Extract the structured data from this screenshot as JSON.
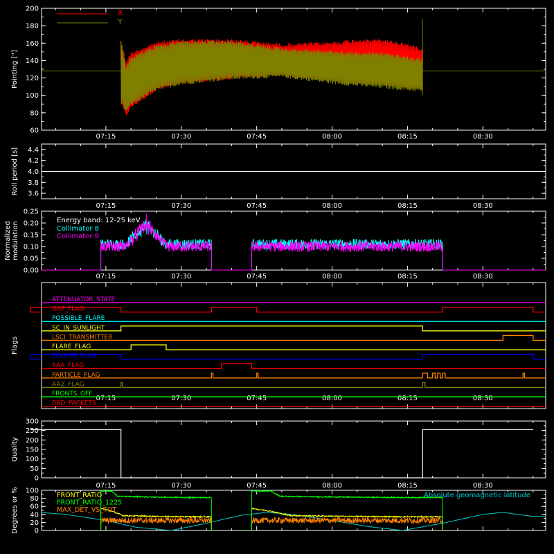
{
  "colors": {
    "background": "#000000",
    "axes": "#ffffff",
    "x_pointing": "#ff0000",
    "y_pointing": "#808000",
    "coll8": "#00ffff",
    "coll9": "#ff00ff",
    "front_ratio": "#ffff00",
    "front_ratio_1225": "#00ff00",
    "max_det_vs_tot": "#ff8000",
    "geomag": "#00cccc"
  },
  "chart_data": [
    {
      "type": "line",
      "ylabel": "Pointing [\"]",
      "ylim": [
        60,
        200
      ],
      "yticks": [
        60,
        80,
        100,
        120,
        140,
        160,
        180,
        200
      ],
      "xticks": [
        "07:15",
        "07:30",
        "07:45",
        "08:00",
        "08:15",
        "08:30"
      ],
      "x_unit": "time",
      "series": [
        {
          "name": "X",
          "color": "#ff0000",
          "t_start": "07:18",
          "t_end": "08:18",
          "envelope": {
            "t": [
              "07:18",
              "07:19",
              "07:20",
              "07:25",
              "07:30",
              "07:40",
              "07:50",
              "08:00",
              "08:05",
              "08:10",
              "08:15",
              "08:18"
            ],
            "max": [
              165,
              140,
              150,
              162,
              165,
              165,
              160,
              162,
              165,
              165,
              160,
              155
            ],
            "min": [
              90,
              75,
              85,
              105,
              112,
              118,
              122,
              117,
              114,
              112,
              108,
              106
            ]
          }
        },
        {
          "name": "Y",
          "color": "#808000",
          "t_start": "07:18",
          "t_end": "08:18",
          "baseline": 128,
          "envelope": {
            "t": [
              "07:18",
              "07:19",
              "07:20",
              "07:25",
              "07:30",
              "07:40",
              "07:50",
              "08:00",
              "08:05",
              "08:10",
              "08:15",
              "08:18"
            ],
            "max": [
              165,
              135,
              145,
              158,
              163,
              163,
              155,
              152,
              150,
              150,
              145,
              142
            ],
            "min": [
              90,
              80,
              88,
              105,
              112,
              118,
              120,
              113,
              110,
              108,
              105,
              104
            ]
          }
        }
      ]
    },
    {
      "type": "line",
      "ylabel": "Roll period [s]",
      "ylim": [
        3.5,
        4.5
      ],
      "yticks": [
        3.6,
        3.8,
        4.0,
        4.2,
        4.4
      ],
      "xticks": [
        "07:15",
        "07:30",
        "07:45",
        "08:00",
        "08:15",
        "08:30"
      ],
      "series": [
        {
          "value": 4.0,
          "color": "#ffffff"
        }
      ]
    },
    {
      "type": "line",
      "ylabel": "Normalized modulation",
      "ylim": [
        0,
        0.25
      ],
      "yticks": [
        0.0,
        0.05,
        0.1,
        0.15,
        0.2,
        0.25
      ],
      "xticks": [
        "07:15",
        "07:30",
        "07:45",
        "08:00",
        "08:15",
        "08:30"
      ],
      "annotation": "Energy band: 12-25 keV",
      "series": [
        {
          "name": "Collimator 8",
          "color": "#00ffff",
          "segments": [
            [
              "07:14",
              "07:36"
            ],
            [
              "07:44",
              "08:22"
            ]
          ],
          "level": 0.11,
          "peak": {
            "t": "07:23",
            "value": 0.24
          }
        },
        {
          "name": "Collimator 9",
          "color": "#ff00ff",
          "segments": [
            [
              "07:14",
              "07:36"
            ],
            [
              "07:44",
              "08:22"
            ]
          ],
          "level": 0.1,
          "peak": {
            "t": "07:23",
            "value": 0.25
          }
        }
      ]
    },
    {
      "type": "line",
      "ylabel": "Flags",
      "xticks": [
        "07:15",
        "07:30",
        "07:45",
        "08:00",
        "08:15",
        "08:30"
      ],
      "series": [
        {
          "name": "ATTENUATOR_STATE",
          "color": "#ff00ff",
          "on": []
        },
        {
          "name": "GAP_FLAG",
          "color": "#ff0000",
          "on": [
            [
              "07:00",
              "07:18"
            ],
            [
              "07:36",
              "07:45"
            ],
            [
              "08:22",
              "08:40"
            ]
          ]
        },
        {
          "name": "POSSIBLE_FLARE",
          "color": "#00ffff",
          "on": []
        },
        {
          "name": "SC_IN_SUNLIGHT",
          "color": "#ffff00",
          "on": [
            [
              "07:18",
              "08:18"
            ]
          ]
        },
        {
          "name": "LSCI_TRANSMITTER",
          "color": "#ff8000",
          "on": [
            [
              "08:34",
              "08:40"
            ]
          ]
        },
        {
          "name": "FLARE_FLAG",
          "color": "#ffff00",
          "on": [
            [
              "07:20",
              "07:27"
            ]
          ]
        },
        {
          "name": "ECLIPSE_FLAG",
          "color": "#0000ff",
          "on": [
            [
              "07:00",
              "07:18"
            ],
            [
              "08:18",
              "08:40"
            ]
          ]
        },
        {
          "name": "SAA_FLAG",
          "color": "#ff0000",
          "on": [
            [
              "07:38",
              "07:44"
            ]
          ]
        },
        {
          "name": "PARTICLE_FLAG",
          "color": "#ff8000",
          "on": [
            [
              "07:36",
              "07:36.3"
            ],
            [
              "07:45",
              "07:45.3"
            ],
            [
              "08:18",
              "08:19"
            ],
            [
              "08:20",
              "08:20.5"
            ],
            [
              "08:21",
              "08:21.5"
            ],
            [
              "08:22",
              "08:22.5"
            ],
            [
              "08:38",
              "08:38.3"
            ]
          ]
        },
        {
          "name": "AAZ_FLAG",
          "color": "#808000",
          "on": [
            [
              "07:18",
              "07:18.3"
            ],
            [
              "08:18",
              "08:18.5"
            ]
          ]
        },
        {
          "name": "FRONTS_OFF",
          "color": "#00ff00",
          "on": []
        },
        {
          "name": "BAD_PACKETS",
          "color": "#ff0000",
          "on": []
        }
      ]
    },
    {
      "type": "line",
      "ylabel": "Quality",
      "ylim": [
        0,
        300
      ],
      "yticks": [
        0,
        50,
        100,
        150,
        200,
        250,
        300
      ],
      "xticks": [
        "07:15",
        "07:30",
        "07:45",
        "08:00",
        "08:15",
        "08:30"
      ],
      "series": [
        {
          "color": "#ffffff",
          "points": [
            [
              "07:00",
              255
            ],
            [
              "07:18",
              255
            ],
            [
              "07:18",
              0
            ],
            [
              "08:18",
              0
            ],
            [
              "08:18",
              255
            ],
            [
              "08:40",
              255
            ]
          ]
        }
      ]
    },
    {
      "type": "line",
      "ylabel": "Degrees or %",
      "ylim": [
        0,
        100
      ],
      "yticks": [
        0,
        20,
        40,
        60,
        80,
        100
      ],
      "series": [
        {
          "name": "FRONT_RATIO",
          "color": "#ffff00",
          "segments": [
            [
              "07:14",
              "07:36"
            ],
            [
              "07:44",
              "08:22"
            ]
          ],
          "shape": [
            [
              0,
              55
            ],
            [
              0.1,
              48
            ],
            [
              0.2,
              37
            ],
            [
              0.5,
              35
            ],
            [
              0.8,
              34
            ],
            [
              1,
              34
            ]
          ]
        },
        {
          "name": "FRONT_RATIO_1225",
          "color": "#00ff00",
          "segments": [
            [
              "07:14",
              "07:36"
            ],
            [
              "07:44",
              "08:22"
            ]
          ],
          "shape": [
            [
              0,
              98
            ],
            [
              0.1,
              98
            ],
            [
              0.15,
              85
            ],
            [
              0.5,
              83
            ],
            [
              0.8,
              82
            ],
            [
              1,
              82
            ]
          ]
        },
        {
          "name": "MAX_DET_VS_TOT",
          "color": "#ff8000",
          "segments": [
            [
              "07:14",
              "07:36"
            ],
            [
              "07:44",
              "08:22"
            ]
          ],
          "level": 25
        },
        {
          "name": "Absolute geomagnetic latitude",
          "color": "#00cccc",
          "points": [
            [
              "07:00",
              42
            ],
            [
              "07:02",
              45
            ],
            [
              "07:07",
              40
            ],
            [
              "07:15",
              25
            ],
            [
              "07:21",
              8
            ],
            [
              "07:28",
              0
            ],
            [
              "07:35",
              18
            ],
            [
              "07:42",
              38
            ],
            [
              "07:47",
              45
            ],
            [
              "07:52",
              40
            ],
            [
              "08:00",
              25
            ],
            [
              "08:07",
              10
            ],
            [
              "08:14",
              0
            ],
            [
              "08:22",
              18
            ],
            [
              "08:30",
              40
            ],
            [
              "08:34",
              45
            ],
            [
              "08:40",
              35
            ]
          ]
        }
      ]
    }
  ]
}
